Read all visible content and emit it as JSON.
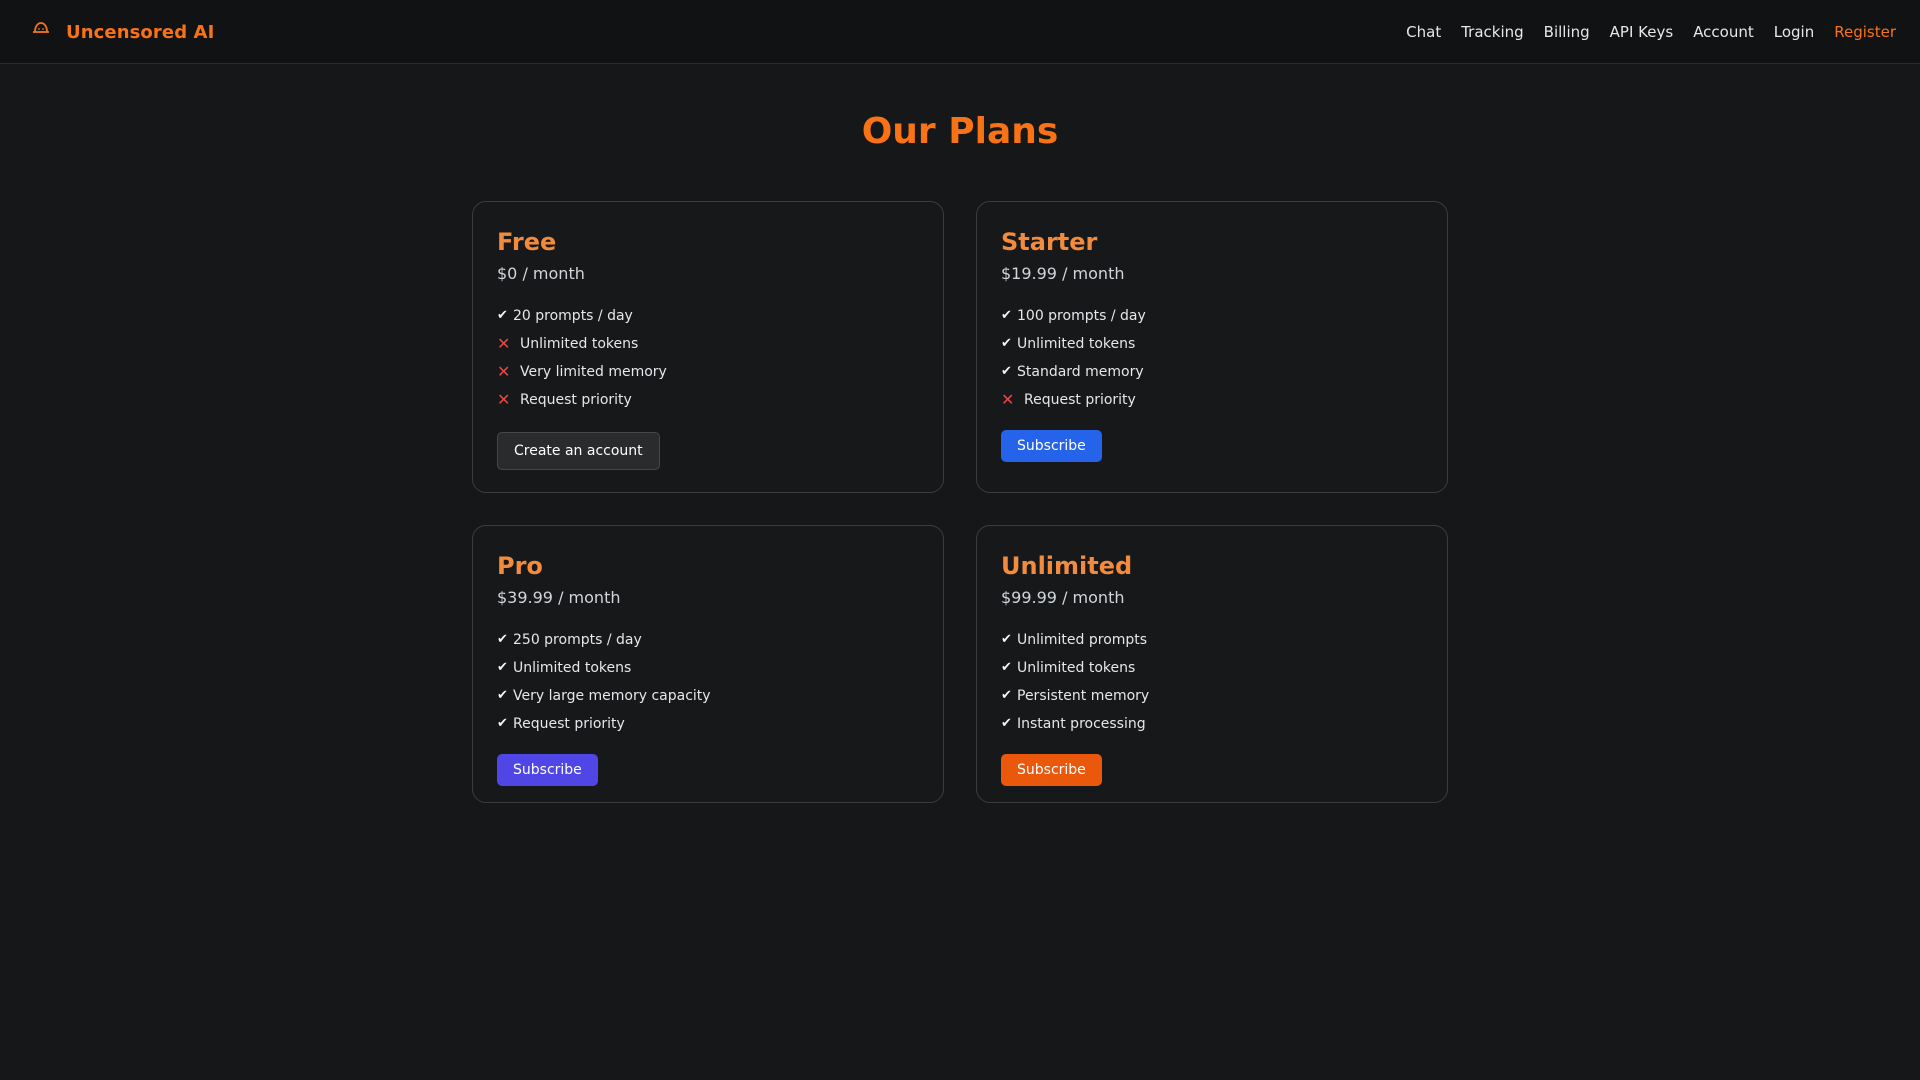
{
  "header": {
    "brand": "Uncensored AI",
    "brand_icon": "hat-icon",
    "nav": [
      {
        "label": "Chat"
      },
      {
        "label": "Tracking"
      },
      {
        "label": "Billing"
      },
      {
        "label": "API Keys"
      },
      {
        "label": "Account"
      },
      {
        "label": "Login"
      },
      {
        "label": "Register"
      }
    ]
  },
  "main": {
    "title": "Our Plans",
    "plans": [
      {
        "name": "Free",
        "price": "$0 / month",
        "features": [
          {
            "included": true,
            "text": "20 prompts / day"
          },
          {
            "included": false,
            "text": "Unlimited tokens"
          },
          {
            "included": false,
            "text": "Very limited memory"
          },
          {
            "included": false,
            "text": "Request priority"
          }
        ],
        "button": "Create an account"
      },
      {
        "name": "Starter",
        "price": "$19.99 / month",
        "features": [
          {
            "included": true,
            "text": "100 prompts / day"
          },
          {
            "included": true,
            "text": "Unlimited tokens"
          },
          {
            "included": true,
            "text": "Standard memory"
          },
          {
            "included": false,
            "text": "Request priority"
          }
        ],
        "button": "Subscribe"
      },
      {
        "name": "Pro",
        "price": "$39.99 / month",
        "features": [
          {
            "included": true,
            "text": "250 prompts / day"
          },
          {
            "included": true,
            "text": "Unlimited tokens"
          },
          {
            "included": true,
            "text": "Very large memory capacity"
          },
          {
            "included": true,
            "text": "Request priority"
          }
        ],
        "button": "Subscribe"
      },
      {
        "name": "Unlimited",
        "price": "$99.99 / month",
        "features": [
          {
            "included": true,
            "text": "Unlimited prompts"
          },
          {
            "included": true,
            "text": "Unlimited tokens"
          },
          {
            "included": true,
            "text": "Persistent memory"
          },
          {
            "included": true,
            "text": "Instant processing"
          }
        ],
        "button": "Subscribe"
      }
    ]
  },
  "icons": {
    "check": "✔",
    "cross": "✕"
  },
  "colors": {
    "accent": "#f97316",
    "background": "#161718",
    "blue_button": "#2563eb",
    "indigo_button": "#4f46e5",
    "orange_button": "#ea580c",
    "cross": "#ef4444"
  }
}
